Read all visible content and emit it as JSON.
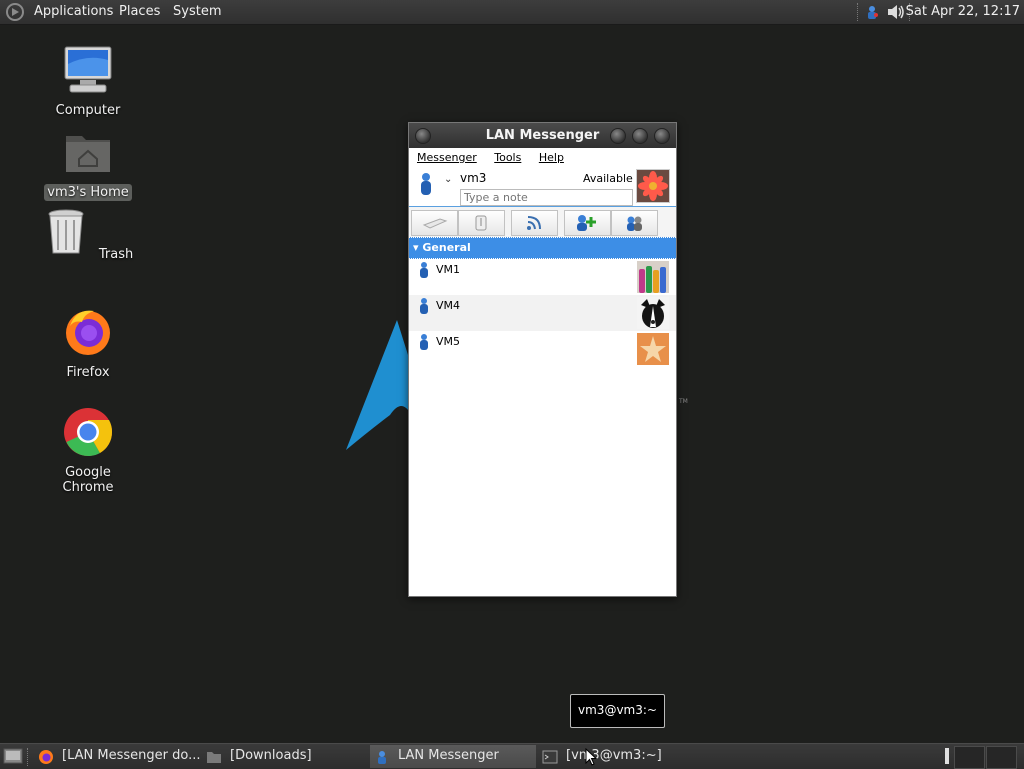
{
  "top_panel": {
    "menus": [
      "Applications",
      "Places",
      "System"
    ],
    "clock": "Sat Apr 22, 12:17"
  },
  "desktop": {
    "icons": [
      {
        "label": "Computer",
        "icon": "computer-icon"
      },
      {
        "label": "vm3's Home",
        "icon": "home-folder-icon",
        "selected": true
      },
      {
        "label": "Trash",
        "icon": "trash-icon"
      },
      {
        "label": "Firefox",
        "icon": "firefox-icon"
      },
      {
        "label": "Google Chrome",
        "icon": "chrome-icon"
      }
    ]
  },
  "messenger": {
    "title": "LAN Messenger",
    "menu": [
      "Messenger",
      "Tools",
      "Help"
    ],
    "user": {
      "name": "vm3",
      "status": "Available",
      "note_placeholder": "Type a note"
    },
    "toolbar": [
      "broadcast-icon",
      "file-transfer-icon",
      "rss-icon",
      "add-contact-icon",
      "contacts-icon"
    ],
    "group": "General",
    "contacts": [
      {
        "name": "VM1",
        "avatar": "bottles-avatar"
      },
      {
        "name": "VM4",
        "avatar": "dog-avatar"
      },
      {
        "name": "VM5",
        "avatar": "starfish-avatar"
      }
    ],
    "accent": "#3d8ee6"
  },
  "tooltip": "vm3@vm3:~",
  "taskbar": {
    "tasks": [
      {
        "label": "[LAN Messenger do...",
        "icon": "firefox-icon",
        "active": false
      },
      {
        "label": "[Downloads]",
        "icon": "folder-icon",
        "active": false
      },
      {
        "label": "LAN Messenger",
        "icon": "messenger-icon",
        "active": true
      },
      {
        "label": "[vm3@vm3:~]",
        "icon": "terminal-icon",
        "active": false
      }
    ]
  }
}
